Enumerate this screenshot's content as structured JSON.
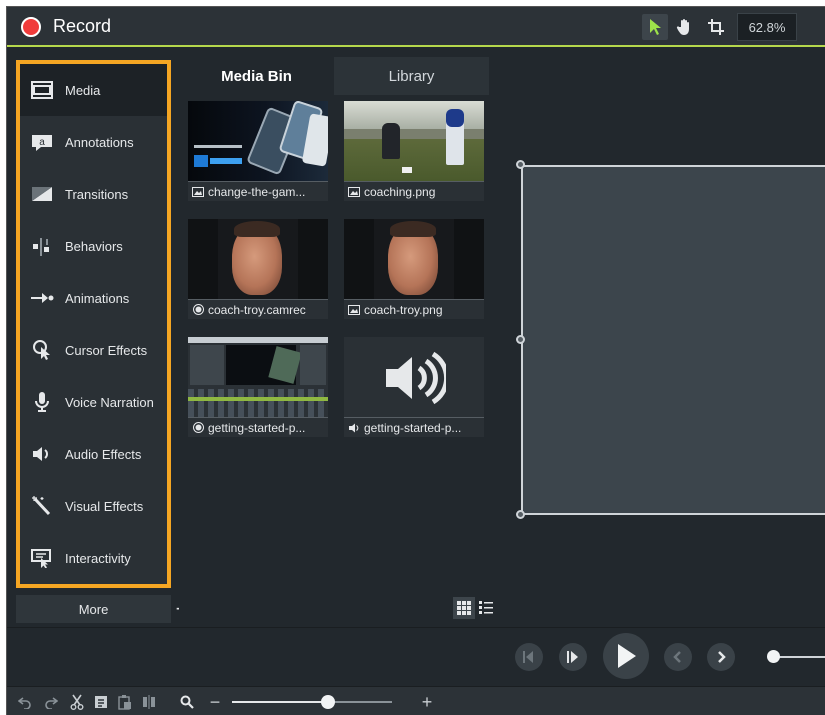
{
  "topbar": {
    "record_label": "Record",
    "zoom_value": "62.8%",
    "tools": [
      "select-arrow-icon",
      "hand-pan-icon",
      "crop-icon"
    ]
  },
  "colors": {
    "record": "#f03b3b",
    "accent_underline": "#b6d84c",
    "highlight_border": "#f5a623",
    "select_tool": "#9ee34a"
  },
  "sidebar": {
    "items": [
      {
        "label": "Media",
        "icon": "film-strip-icon",
        "selected": true
      },
      {
        "label": "Annotations",
        "icon": "callout-icon"
      },
      {
        "label": "Transitions",
        "icon": "transition-icon"
      },
      {
        "label": "Behaviors",
        "icon": "behaviors-icon"
      },
      {
        "label": "Animations",
        "icon": "animation-arrow-icon"
      },
      {
        "label": "Cursor Effects",
        "icon": "cursor-effect-icon"
      },
      {
        "label": "Voice Narration",
        "icon": "microphone-icon"
      },
      {
        "label": "Audio Effects",
        "icon": "speaker-icon"
      },
      {
        "label": "Visual Effects",
        "icon": "magic-wand-icon"
      },
      {
        "label": "Interactivity",
        "icon": "interactivity-icon"
      }
    ],
    "more_label": "More",
    "add_label": "+"
  },
  "bin": {
    "tabs": [
      {
        "label": "Media Bin",
        "active": true
      },
      {
        "label": "Library",
        "active": false
      }
    ],
    "items": [
      {
        "caption": "change-the-gam...",
        "type": "image"
      },
      {
        "caption": "coaching.png",
        "type": "image"
      },
      {
        "caption": "coach-troy.camrec",
        "type": "recording"
      },
      {
        "caption": "coach-troy.png",
        "type": "image"
      },
      {
        "caption": "getting-started-p...",
        "type": "recording"
      },
      {
        "caption": "getting-started-p...",
        "type": "audio"
      }
    ],
    "view_modes": [
      "grid-view-icon",
      "list-view-icon"
    ]
  },
  "timeline_toolbar": {
    "zoom_minus": "−",
    "zoom_plus": "+",
    "zoom_fraction": 0.6
  }
}
